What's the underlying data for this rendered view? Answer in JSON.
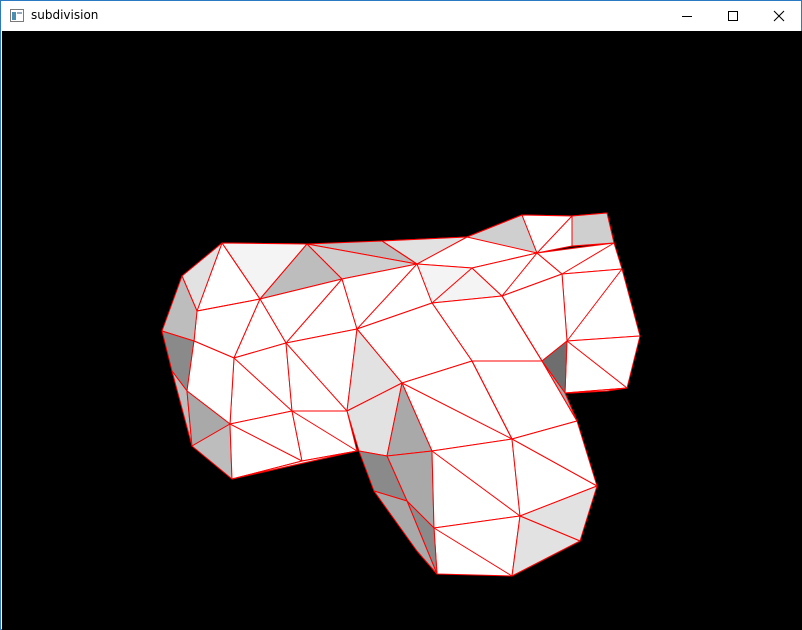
{
  "window": {
    "title": "subdivision",
    "controls": {
      "minimize": "minimize",
      "maximize": "maximize",
      "close": "close"
    }
  },
  "scene": {
    "background": "#000000",
    "edge_color": "#ff0000",
    "face_shades": [
      "#ffffff",
      "#f4f4f4",
      "#e2e2e2",
      "#cfcfcf",
      "#bdbdbd",
      "#a9a9a9",
      "#8a8a8a",
      "#6e6e6e"
    ]
  }
}
